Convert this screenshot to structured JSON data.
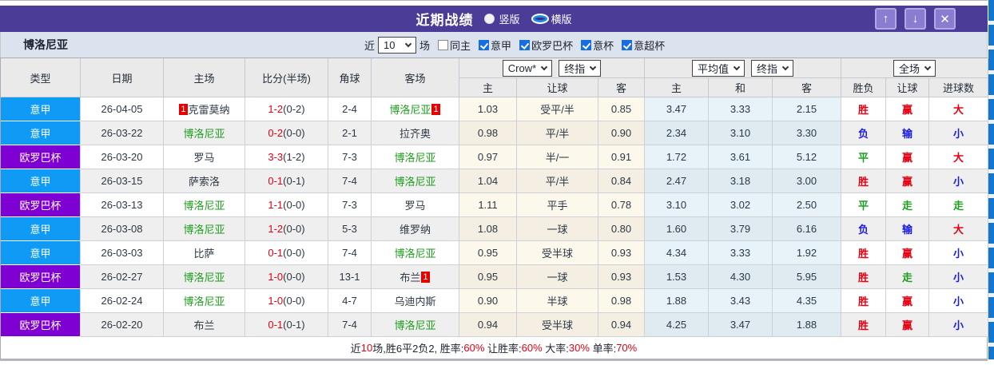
{
  "titlebar": {
    "title": "近期战绩",
    "layout_options": [
      {
        "label": "竖版",
        "selected": false
      },
      {
        "label": "横版",
        "selected": true
      }
    ],
    "up_icon": "↑",
    "down_icon": "↓",
    "close_icon": "✕"
  },
  "filter": {
    "team": "博洛尼亚",
    "recent_label": "近",
    "recent_count": "10",
    "unit_label": "场",
    "options": [
      {
        "label": "同主",
        "checked": false
      },
      {
        "label": "意甲",
        "checked": true
      },
      {
        "label": "欧罗巴杯",
        "checked": true
      },
      {
        "label": "意杯",
        "checked": true
      },
      {
        "label": "意超杯",
        "checked": true
      }
    ]
  },
  "table": {
    "main_headers": [
      "类型",
      "日期",
      "主场",
      "比分(半场)",
      "角球",
      "客场"
    ],
    "group1": {
      "select1": "Crow*",
      "select2": "终指",
      "subs": [
        "主",
        "让球",
        "客"
      ]
    },
    "group2": {
      "select1": "平均值",
      "select2": "终指",
      "subs": [
        "主",
        "和",
        "客"
      ]
    },
    "group3": {
      "select1": "全场",
      "subs": [
        "胜负",
        "让球",
        "进球数"
      ]
    },
    "rows": [
      {
        "type": "意甲",
        "type_bg": "#0f9bf5",
        "date": "26-04-05",
        "home": {
          "pre": "1",
          "name": "克雷莫纳",
          "color": "#2f3b47"
        },
        "score": {
          "ft": "1-2",
          "ht": "(0-2)"
        },
        "corner": "2-4",
        "away": {
          "name": "博洛尼亚",
          "post": "1",
          "color": "#1f9e1f"
        },
        "ah": [
          "1.03",
          "受平/半",
          "0.85"
        ],
        "eu": [
          "3.47",
          "3.33",
          "2.15"
        ],
        "res": {
          "t": "胜",
          "c": "#e60012"
        },
        "hc": {
          "t": "赢",
          "c": "#e60012"
        },
        "gl": {
          "t": "大",
          "c": "#e60012"
        }
      },
      {
        "type": "意甲",
        "type_bg": "#0f9bf5",
        "date": "26-03-22",
        "home": {
          "name": "博洛尼亚",
          "color": "#1f9e1f"
        },
        "score": {
          "ft": "0-2",
          "ht": "(0-0)"
        },
        "corner": "2-1",
        "away": {
          "name": "拉齐奥",
          "color": "#2f3b47"
        },
        "ah": [
          "0.98",
          "平/半",
          "0.90"
        ],
        "eu": [
          "2.34",
          "3.10",
          "3.30"
        ],
        "res": {
          "t": "负",
          "c": "#1a1ae6"
        },
        "hc": {
          "t": "输",
          "c": "#1a1ae6"
        },
        "gl": {
          "t": "小",
          "c": "#1a1ae6"
        }
      },
      {
        "type": "欧罗巴杯",
        "type_bg": "#7f00d2",
        "date": "26-03-20",
        "home": {
          "name": "罗马",
          "color": "#2f3b47"
        },
        "score": {
          "ft": "3-3",
          "ht": "(1-2)"
        },
        "corner": "7-3",
        "away": {
          "name": "博洛尼亚",
          "color": "#1f9e1f"
        },
        "ah": [
          "0.97",
          "半/一",
          "0.91"
        ],
        "eu": [
          "1.72",
          "3.61",
          "5.12"
        ],
        "res": {
          "t": "平",
          "c": "#1f9e1f"
        },
        "hc": {
          "t": "赢",
          "c": "#e60012"
        },
        "gl": {
          "t": "大",
          "c": "#e60012"
        }
      },
      {
        "type": "意甲",
        "type_bg": "#0f9bf5",
        "date": "26-03-15",
        "home": {
          "name": "萨索洛",
          "color": "#2f3b47"
        },
        "score": {
          "ft": "0-1",
          "ht": "(0-1)"
        },
        "corner": "7-4",
        "away": {
          "name": "博洛尼亚",
          "color": "#1f9e1f"
        },
        "ah": [
          "1.04",
          "平/半",
          "0.84"
        ],
        "eu": [
          "2.47",
          "3.18",
          "3.00"
        ],
        "res": {
          "t": "胜",
          "c": "#e60012"
        },
        "hc": {
          "t": "赢",
          "c": "#e60012"
        },
        "gl": {
          "t": "小",
          "c": "#1a1ae6"
        }
      },
      {
        "type": "欧罗巴杯",
        "type_bg": "#7f00d2",
        "date": "26-03-13",
        "home": {
          "name": "博洛尼亚",
          "color": "#1f9e1f"
        },
        "score": {
          "ft": "1-1",
          "ht": "(0-0)"
        },
        "corner": "7-3",
        "away": {
          "name": "罗马",
          "color": "#2f3b47"
        },
        "ah": [
          "1.11",
          "平手",
          "0.78"
        ],
        "eu": [
          "3.10",
          "3.02",
          "2.50"
        ],
        "res": {
          "t": "平",
          "c": "#1f9e1f"
        },
        "hc": {
          "t": "走",
          "c": "#1f9e1f"
        },
        "gl": {
          "t": "走",
          "c": "#1f9e1f"
        }
      },
      {
        "type": "意甲",
        "type_bg": "#0f9bf5",
        "date": "26-03-08",
        "home": {
          "name": "博洛尼亚",
          "color": "#1f9e1f"
        },
        "score": {
          "ft": "1-2",
          "ht": "(0-0)"
        },
        "corner": "5-3",
        "away": {
          "name": "维罗纳",
          "color": "#2f3b47"
        },
        "ah": [
          "1.08",
          "一球",
          "0.80"
        ],
        "eu": [
          "1.60",
          "3.79",
          "6.16"
        ],
        "res": {
          "t": "负",
          "c": "#1a1ae6"
        },
        "hc": {
          "t": "输",
          "c": "#1a1ae6"
        },
        "gl": {
          "t": "大",
          "c": "#e60012"
        }
      },
      {
        "type": "意甲",
        "type_bg": "#0f9bf5",
        "date": "26-03-03",
        "home": {
          "name": "比萨",
          "color": "#2f3b47"
        },
        "score": {
          "ft": "0-1",
          "ht": "(0-0)"
        },
        "corner": "7-4",
        "away": {
          "name": "博洛尼亚",
          "color": "#1f9e1f"
        },
        "ah": [
          "0.95",
          "受半球",
          "0.93"
        ],
        "eu": [
          "4.34",
          "3.33",
          "1.92"
        ],
        "res": {
          "t": "胜",
          "c": "#e60012"
        },
        "hc": {
          "t": "赢",
          "c": "#e60012"
        },
        "gl": {
          "t": "小",
          "c": "#1a1ae6"
        }
      },
      {
        "type": "欧罗巴杯",
        "type_bg": "#7f00d2",
        "date": "26-02-27",
        "home": {
          "name": "博洛尼亚",
          "color": "#1f9e1f"
        },
        "score": {
          "ft": "1-0",
          "ht": "(0-0)"
        },
        "corner": "13-1",
        "away": {
          "name": "布兰",
          "post": "1",
          "color": "#2f3b47"
        },
        "ah": [
          "0.95",
          "一球",
          "0.93"
        ],
        "eu": [
          "1.53",
          "4.30",
          "5.95"
        ],
        "res": {
          "t": "胜",
          "c": "#e60012"
        },
        "hc": {
          "t": "走",
          "c": "#1f9e1f"
        },
        "gl": {
          "t": "小",
          "c": "#1a1ae6"
        }
      },
      {
        "type": "意甲",
        "type_bg": "#0f9bf5",
        "date": "26-02-24",
        "home": {
          "name": "博洛尼亚",
          "color": "#1f9e1f"
        },
        "score": {
          "ft": "1-0",
          "ht": "(0-0)"
        },
        "corner": "4-7",
        "away": {
          "name": "乌迪内斯",
          "color": "#2f3b47"
        },
        "ah": [
          "0.90",
          "半球",
          "0.98"
        ],
        "eu": [
          "1.88",
          "3.43",
          "4.35"
        ],
        "res": {
          "t": "胜",
          "c": "#e60012"
        },
        "hc": {
          "t": "赢",
          "c": "#e60012"
        },
        "gl": {
          "t": "小",
          "c": "#1a1ae6"
        }
      },
      {
        "type": "欧罗巴杯",
        "type_bg": "#7f00d2",
        "date": "26-02-20",
        "home": {
          "name": "布兰",
          "color": "#2f3b47"
        },
        "score": {
          "ft": "0-1",
          "ht": "(0-1)"
        },
        "corner": "7-4",
        "away": {
          "name": "博洛尼亚",
          "color": "#1f9e1f"
        },
        "ah": [
          "0.94",
          "受半球",
          "0.94"
        ],
        "eu": [
          "4.25",
          "3.47",
          "1.88"
        ],
        "res": {
          "t": "胜",
          "c": "#e60012"
        },
        "hc": {
          "t": "赢",
          "c": "#e60012"
        },
        "gl": {
          "t": "小",
          "c": "#1a1ae6"
        }
      }
    ]
  },
  "footer": {
    "segments": [
      {
        "t": "近",
        "c": "#222733"
      },
      {
        "t": "10",
        "c": "#e60012"
      },
      {
        "t": "场,胜6平2负2, 胜率:",
        "c": "#222733"
      },
      {
        "t": "60%",
        "c": "#e60012"
      },
      {
        "t": " 让胜率:",
        "c": "#222733"
      },
      {
        "t": "60%",
        "c": "#e60012"
      },
      {
        "t": " 大率:",
        "c": "#222733"
      },
      {
        "t": "30%",
        "c": "#e60012"
      },
      {
        "t": " 单率:",
        "c": "#222733"
      },
      {
        "t": "70%",
        "c": "#e60012"
      }
    ]
  }
}
